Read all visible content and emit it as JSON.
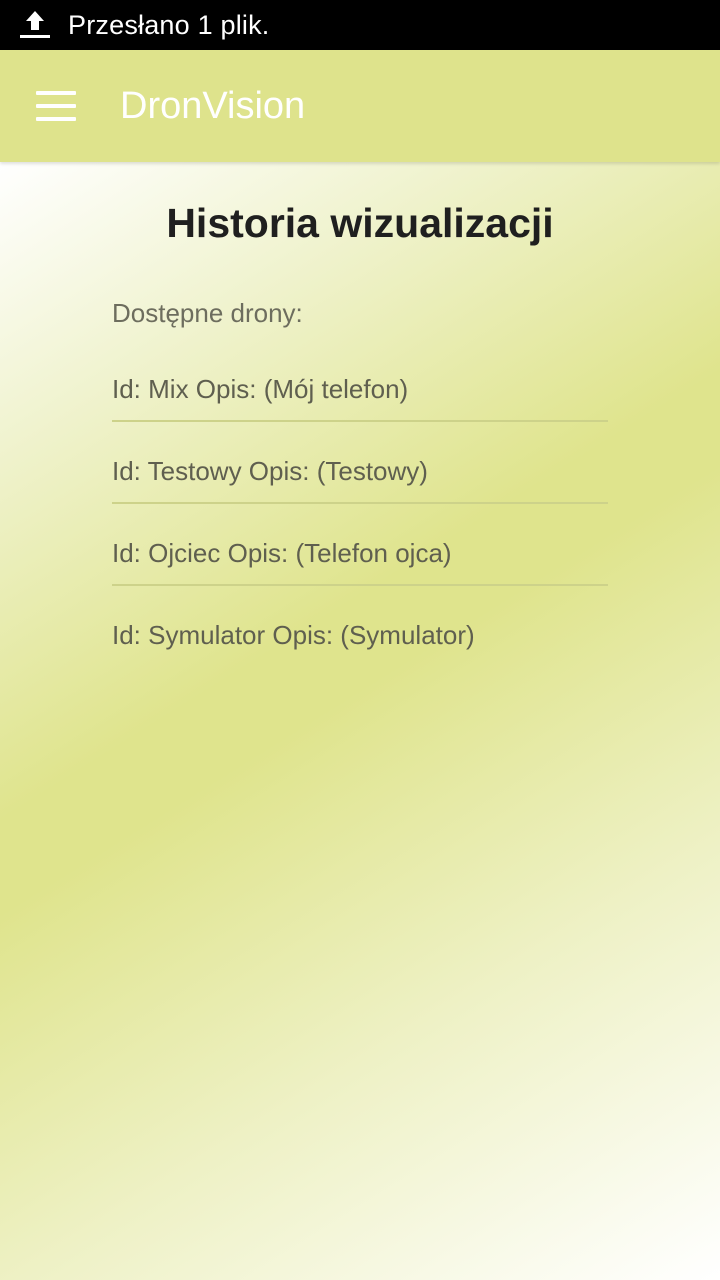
{
  "status_bar": {
    "icon": "upload-icon",
    "text": "Przesłano 1 plik."
  },
  "app_bar": {
    "menu_icon": "menu-icon",
    "title": "DronVision"
  },
  "main": {
    "title": "Historia wizualizacji",
    "section_label": "Dostępne drony:",
    "drones": [
      "Id: Mix Opis: (Mój telefon)",
      "Id: Testowy Opis: (Testowy)",
      "Id: Ojciec Opis: (Telefon ojca)",
      "Id: Symulator Opis: (Symulator)"
    ]
  },
  "colors": {
    "status_bar_bg": "#000000",
    "app_bar_bg": "#dee38c",
    "content_gradient_mid": "#dfe48d",
    "divider": "#cdd28a",
    "title_text": "#1f1f1f",
    "item_text": "#5f5f4f"
  }
}
